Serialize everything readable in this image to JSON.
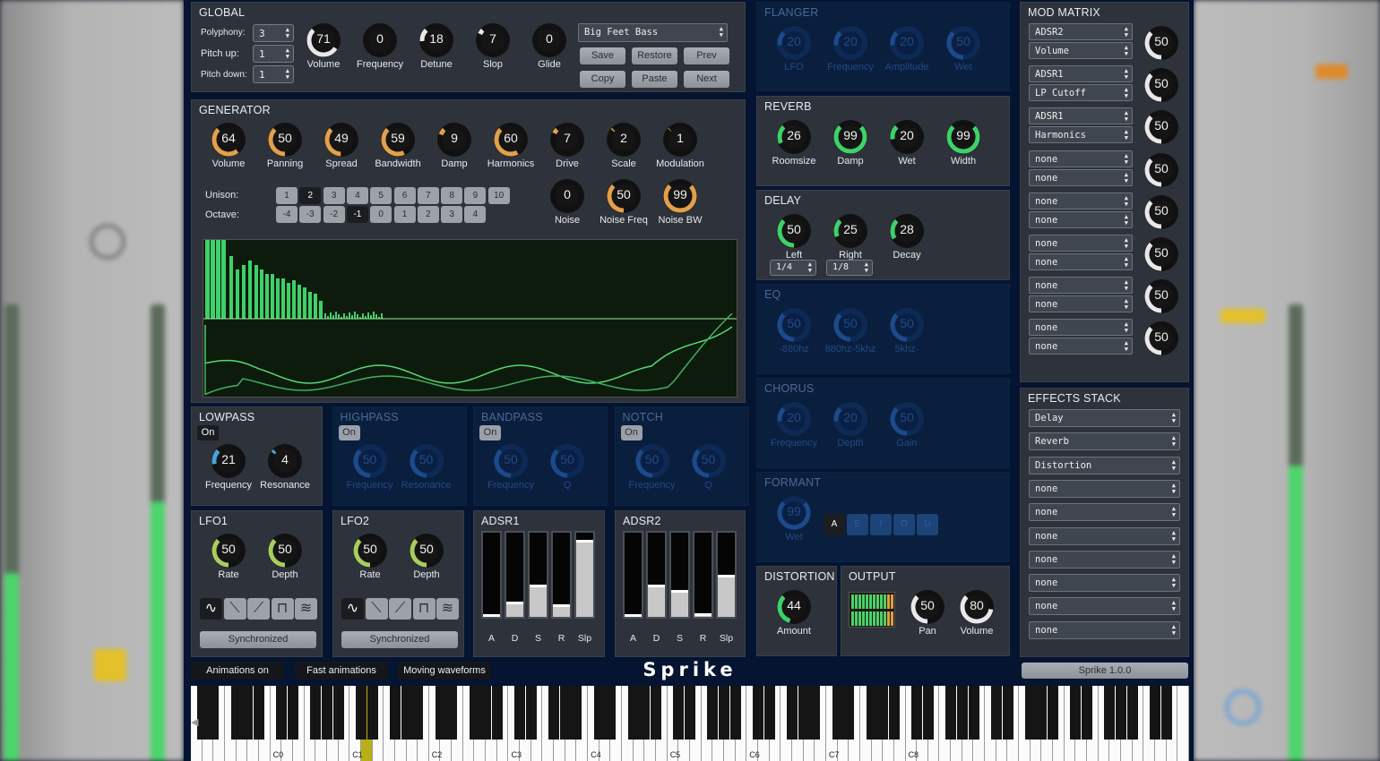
{
  "app_title": "Sprike",
  "version": "Sprike 1.0.0",
  "colors": {
    "bg": "#041431",
    "panel": "#2e323a",
    "orange": "#e1a04a",
    "green": "#3ed16a",
    "lime": "#a8cc5e",
    "blue": "#4aa3d8",
    "off": "#1c4a8a"
  },
  "global": {
    "title": "GLOBAL",
    "polyphony": {
      "label": "Polyphony:",
      "value": "3"
    },
    "pitch_up": {
      "label": "Pitch up:",
      "value": "1"
    },
    "pitch_down": {
      "label": "Pitch down:",
      "value": "1"
    },
    "knobs": [
      {
        "label": "Volume",
        "value": 71
      },
      {
        "label": "Frequency",
        "value": 0
      },
      {
        "label": "Detune",
        "value": 18
      },
      {
        "label": "Slop",
        "value": 7
      },
      {
        "label": "Glide",
        "value": 0
      }
    ],
    "preset": "Big Feet Bass",
    "buttons": [
      "Save",
      "Restore",
      "Prev",
      "Copy",
      "Paste",
      "Next"
    ]
  },
  "generator": {
    "title": "GENERATOR",
    "knobs": [
      {
        "label": "Volume",
        "value": 64
      },
      {
        "label": "Panning",
        "value": 50
      },
      {
        "label": "Spread",
        "value": 49
      },
      {
        "label": "Bandwidth",
        "value": 59
      },
      {
        "label": "Damp",
        "value": 9
      },
      {
        "label": "Harmonics",
        "value": 60
      },
      {
        "label": "Drive",
        "value": 7
      },
      {
        "label": "Scale",
        "value": 2
      },
      {
        "label": "Modulation",
        "value": 1
      }
    ],
    "unison_label": "Unison:",
    "unison": [
      "1",
      "2",
      "3",
      "4",
      "5",
      "6",
      "7",
      "8",
      "9",
      "10"
    ],
    "unison_selected": "2",
    "octave_label": "Octave:",
    "octave": [
      "-4",
      "-3",
      "-2",
      "-1",
      "0",
      "1",
      "2",
      "3",
      "4"
    ],
    "octave_selected": "-1",
    "noise_knobs": [
      {
        "label": "Noise",
        "value": 0
      },
      {
        "label": "Noise Freq",
        "value": 50
      },
      {
        "label": "Noise BW",
        "value": 99
      }
    ]
  },
  "filters": [
    {
      "title": "LOWPASS",
      "on": "On",
      "active": true,
      "knobs": [
        {
          "label": "Frequency",
          "value": 21
        },
        {
          "label": "Resonance",
          "value": 4
        }
      ]
    },
    {
      "title": "HIGHPASS",
      "on": "On",
      "active": false,
      "knobs": [
        {
          "label": "Frequency",
          "value": 50
        },
        {
          "label": "Resonance",
          "value": 50
        }
      ]
    },
    {
      "title": "BANDPASS",
      "on": "On",
      "active": false,
      "knobs": [
        {
          "label": "Frequency",
          "value": 50
        },
        {
          "label": "Q",
          "value": 50
        }
      ]
    },
    {
      "title": "NOTCH",
      "on": "On",
      "active": false,
      "knobs": [
        {
          "label": "Frequency",
          "value": 50
        },
        {
          "label": "Q",
          "value": 50
        }
      ]
    }
  ],
  "lfos": [
    {
      "title": "LFO1",
      "knobs": [
        {
          "label": "Rate",
          "value": 50
        },
        {
          "label": "Depth",
          "value": 50
        }
      ],
      "waves": [
        "sine-wave-icon",
        "saw-down-icon",
        "saw-up-icon",
        "square-wave-icon",
        "noise-wave-icon"
      ],
      "sync": "Synchronized"
    },
    {
      "title": "LFO2",
      "knobs": [
        {
          "label": "Rate",
          "value": 50
        },
        {
          "label": "Depth",
          "value": 50
        }
      ],
      "waves": [
        "sine-wave-icon",
        "saw-down-icon",
        "saw-up-icon",
        "square-wave-icon",
        "noise-wave-icon"
      ],
      "sync": "Synchronized"
    }
  ],
  "adsrs": [
    {
      "title": "ADSR1",
      "labels": [
        "A",
        "D",
        "S",
        "R",
        "Slp"
      ],
      "levels": [
        0.02,
        0.18,
        0.38,
        0.15,
        0.92
      ]
    },
    {
      "title": "ADSR2",
      "labels": [
        "A",
        "D",
        "S",
        "R",
        "Slp"
      ],
      "levels": [
        0.02,
        0.38,
        0.32,
        0.04,
        0.5
      ]
    }
  ],
  "flanger": {
    "title": "FLANGER",
    "knobs": [
      {
        "label": "LFO",
        "value": 20
      },
      {
        "label": "Frequency",
        "value": 20
      },
      {
        "label": "Amplitude",
        "value": 20
      },
      {
        "label": "Wet",
        "value": 50
      }
    ]
  },
  "reverb": {
    "title": "REVERB",
    "knobs": [
      {
        "label": "Roomsize",
        "value": 26
      },
      {
        "label": "Damp",
        "value": 99
      },
      {
        "label": "Wet",
        "value": 20
      },
      {
        "label": "Width",
        "value": 99
      }
    ]
  },
  "delay": {
    "title": "DELAY",
    "knobs": [
      {
        "label": "Left",
        "value": 50
      },
      {
        "label": "Right",
        "value": 25
      },
      {
        "label": "Decay",
        "value": 28
      }
    ],
    "left_sync": "1/4",
    "right_sync": "1/8"
  },
  "eq": {
    "title": "EQ",
    "knobs": [
      {
        "label": "-880hz",
        "value": 50
      },
      {
        "label": "880hz-5khz",
        "value": 50
      },
      {
        "label": "5khz-",
        "value": 50
      }
    ]
  },
  "chorus": {
    "title": "CHORUS",
    "knobs": [
      {
        "label": "Frequency",
        "value": 20
      },
      {
        "label": "Depth",
        "value": 20
      },
      {
        "label": "Gain",
        "value": 50
      }
    ]
  },
  "formant": {
    "title": "FORMANT",
    "knob": {
      "label": "Wet",
      "value": 99
    },
    "vowels": [
      "A",
      "E",
      "I",
      "O",
      "U"
    ],
    "selected": "A"
  },
  "distortion": {
    "title": "DISTORTION",
    "knob": {
      "label": "Amount",
      "value": 44
    }
  },
  "output": {
    "title": "OUTPUT",
    "knobs": [
      {
        "label": "Pan",
        "value": 50
      },
      {
        "label": "Volume",
        "value": 80
      }
    ]
  },
  "mod_matrix": {
    "title": "MOD MATRIX",
    "rows": [
      {
        "source": "ADSR2",
        "target": "Volume",
        "amount": 50
      },
      {
        "source": "ADSR1",
        "target": "LP Cutoff",
        "amount": 50
      },
      {
        "source": "ADSR1",
        "target": "Harmonics",
        "amount": 50
      },
      {
        "source": "none",
        "target": "none",
        "amount": 50
      },
      {
        "source": "none",
        "target": "none",
        "amount": 50
      },
      {
        "source": "none",
        "target": "none",
        "amount": 50
      },
      {
        "source": "none",
        "target": "none",
        "amount": 50
      },
      {
        "source": "none",
        "target": "none",
        "amount": 50
      }
    ]
  },
  "effects_stack": {
    "title": "EFFECTS STACK",
    "items": [
      "Delay",
      "Reverb",
      "Distortion",
      "none",
      "none",
      "none",
      "none",
      "none",
      "none",
      "none"
    ]
  },
  "footer": {
    "animations": "Animations on",
    "fast": "Fast animations",
    "moving": "Moving waveforms"
  },
  "keyboard": {
    "octave_labels": [
      "C0",
      "C1",
      "C2",
      "C3",
      "C4",
      "C5",
      "C6",
      "C7",
      "C8"
    ],
    "highlighted_key": "D2"
  }
}
